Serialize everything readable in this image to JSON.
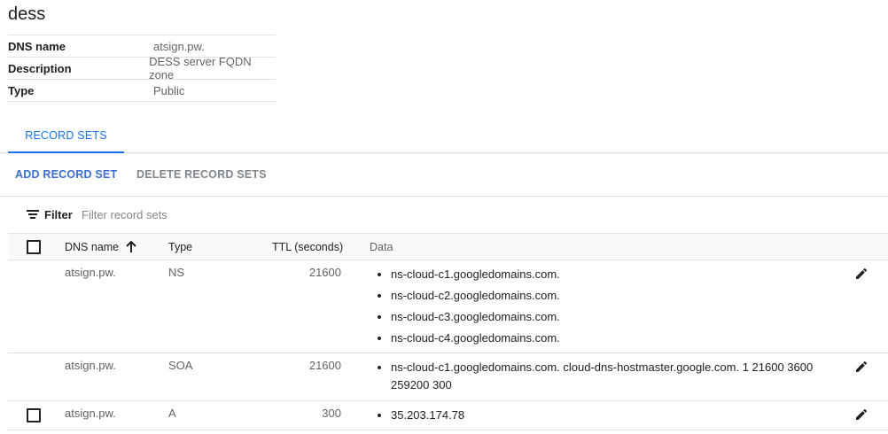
{
  "zone": {
    "title": "dess"
  },
  "details": [
    {
      "key": "DNS name",
      "value": "atsign.pw."
    },
    {
      "key": "Description",
      "value": "DESS server FQDN zone"
    },
    {
      "key": "Type",
      "value": "Public"
    }
  ],
  "tabs": [
    {
      "label": "RECORD SETS",
      "active": true
    }
  ],
  "actions": {
    "add_label": "ADD RECORD SET",
    "delete_label": "DELETE RECORD SETS"
  },
  "filter": {
    "label": "Filter",
    "placeholder": "Filter record sets",
    "value": "",
    "icon": "filter-list-icon"
  },
  "table": {
    "columns": {
      "name": "DNS name",
      "type": "Type",
      "ttl": "TTL (seconds)",
      "data": "Data"
    },
    "sort": {
      "column": "name",
      "direction": "ascending",
      "icon": "arrow-upward-icon"
    },
    "rows": [
      {
        "name": "atsign.pw.",
        "type": "NS",
        "ttl": "21600",
        "data": [
          "ns-cloud-c1.googledomains.com.",
          "ns-cloud-c2.googledomains.com.",
          "ns-cloud-c3.googledomains.com.",
          "ns-cloud-c4.googledomains.com."
        ],
        "selectable": false
      },
      {
        "name": "atsign.pw.",
        "type": "SOA",
        "ttl": "21600",
        "data": [
          "ns-cloud-c1.googledomains.com. cloud-dns-hostmaster.google.com. 1 21600 3600 259200 300"
        ],
        "selectable": false
      },
      {
        "name": "atsign.pw.",
        "type": "A",
        "ttl": "300",
        "data": [
          "35.203.174.78"
        ],
        "selectable": true
      }
    ]
  },
  "colors": {
    "accent": "#1a73e8",
    "text": "#202124",
    "muted": "#5f6368",
    "divider": "#e0e0e0"
  }
}
